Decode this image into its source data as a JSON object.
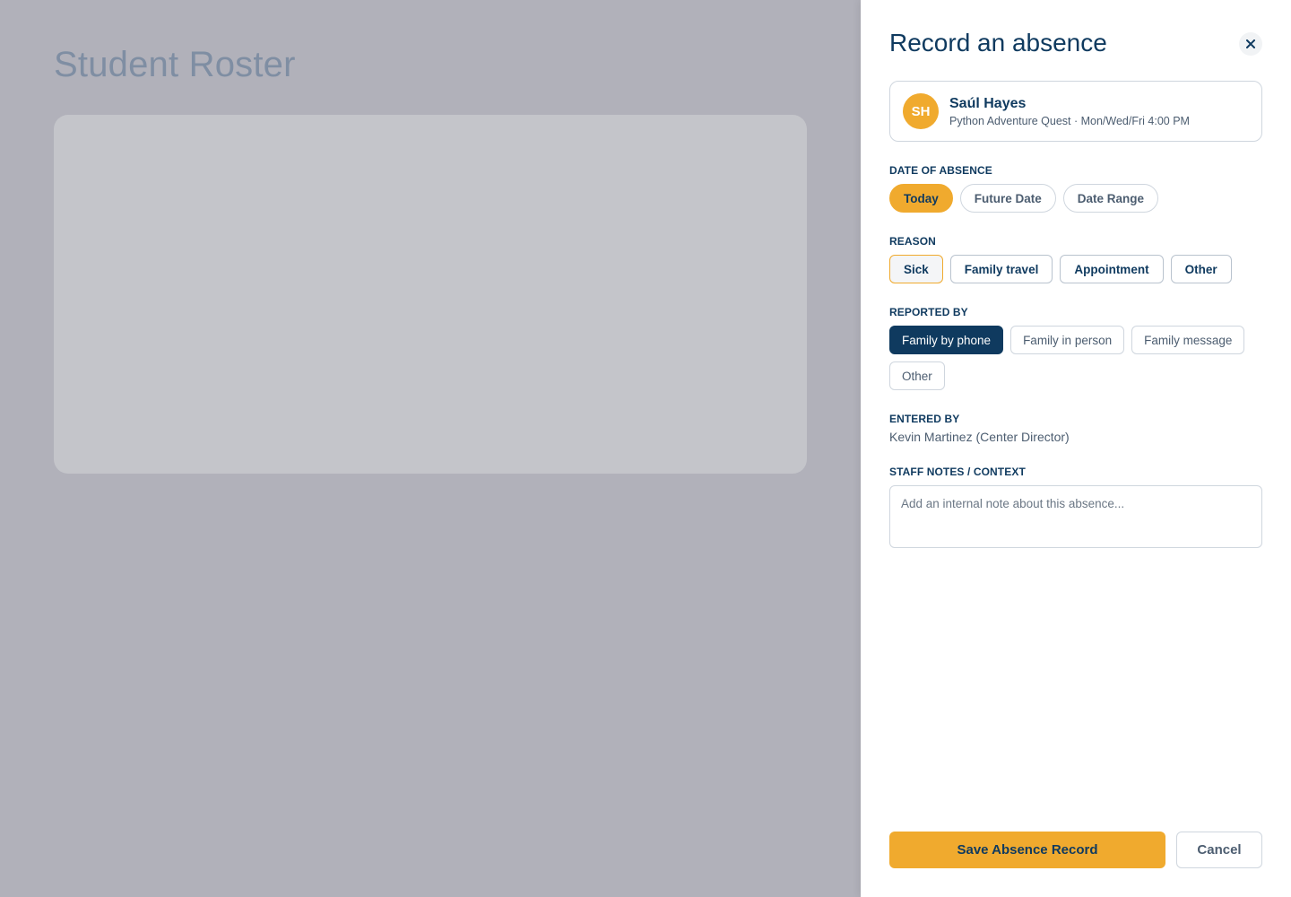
{
  "background": {
    "title": "Student Roster"
  },
  "drawer": {
    "title": "Record an absence",
    "close_icon": "close-icon"
  },
  "student": {
    "initials": "SH",
    "name": "Saúl Hayes",
    "subtitle": "Python Adventure Quest · Mon/Wed/Fri 4:00 PM"
  },
  "date_section": {
    "label": "DATE OF ABSENCE",
    "options": [
      "Today",
      "Future Date",
      "Date Range"
    ],
    "selected": "Today"
  },
  "reason_section": {
    "label": "REASON",
    "options": [
      "Sick",
      "Family travel",
      "Appointment",
      "Other"
    ],
    "selected": "Sick"
  },
  "reported_section": {
    "label": "REPORTED BY",
    "options": [
      "Family by phone",
      "Family in person",
      "Family message",
      "Other"
    ],
    "selected": "Family by phone"
  },
  "entered_section": {
    "label": "ENTERED BY",
    "value": "Kevin Martinez (Center Director)"
  },
  "notes_section": {
    "label": "STAFF NOTES / CONTEXT",
    "placeholder": "Add an internal note about this absence...",
    "value": ""
  },
  "actions": {
    "save_label": "Save Absence Record",
    "cancel_label": "Cancel"
  },
  "colors": {
    "accent": "#f0aa2e",
    "navy": "#0f3a5f",
    "overlay": "#b1b1ba"
  }
}
